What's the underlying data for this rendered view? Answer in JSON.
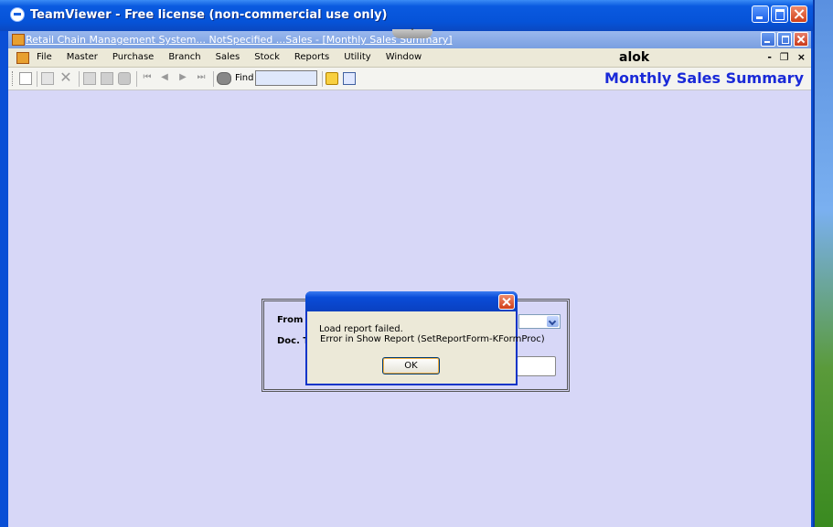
{
  "teamviewer": {
    "title": "TeamViewer - Free license (non-commercial use only)"
  },
  "mdi": {
    "title": "Retail Chain Management System... NotSpecified    ...Sales - [Monthly Sales Summary]",
    "handle_glyph": "˅"
  },
  "menu": {
    "items": [
      "File",
      "Master",
      "Purchase",
      "Branch",
      "Sales",
      "Stock",
      "Reports",
      "Utility",
      "Window"
    ],
    "user": "alok",
    "right": [
      "-",
      "❐",
      "×"
    ]
  },
  "toolbar": {
    "find_label": "Find",
    "find_value": "",
    "form_title": "Monthly Sales Summary"
  },
  "report_form": {
    "from_label": "From D",
    "doctype_label": "Doc. Ty"
  },
  "dialog": {
    "line1": "Load report failed.",
    "line2": "Error in Show Report (SetReportForm-KFormProc)",
    "ok_label": "OK"
  },
  "colors": {
    "xp_blue": "#0a4fd6",
    "workspace": "#d7d7f7",
    "form_title": "#1a2ad8"
  }
}
